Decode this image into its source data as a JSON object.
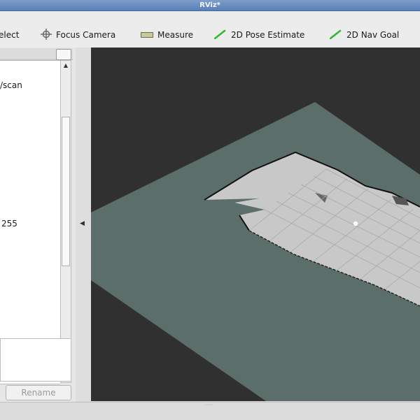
{
  "window": {
    "title": "RViz*"
  },
  "toolbar": {
    "items": [
      {
        "label": "elect",
        "icon": "select-cursor-icon"
      },
      {
        "label": "Focus Camera",
        "icon": "focus-crosshair-icon"
      },
      {
        "label": "Measure",
        "icon": "ruler-icon"
      },
      {
        "label": "2D Pose Estimate",
        "icon": "green-arrow-icon"
      },
      {
        "label": "2D Nav Goal",
        "icon": "green-arrow-icon"
      }
    ]
  },
  "displays_panel": {
    "rows": [
      {
        "text": "/scan"
      },
      {
        "text": "255"
      }
    ],
    "rename_label": "Rename"
  },
  "colors": {
    "viewport_bg": "#303030",
    "ground_plane": "#5c6e6a",
    "map_free": "#c8c8c8",
    "map_walls": "#111111",
    "tool_green": "#2db82d"
  }
}
